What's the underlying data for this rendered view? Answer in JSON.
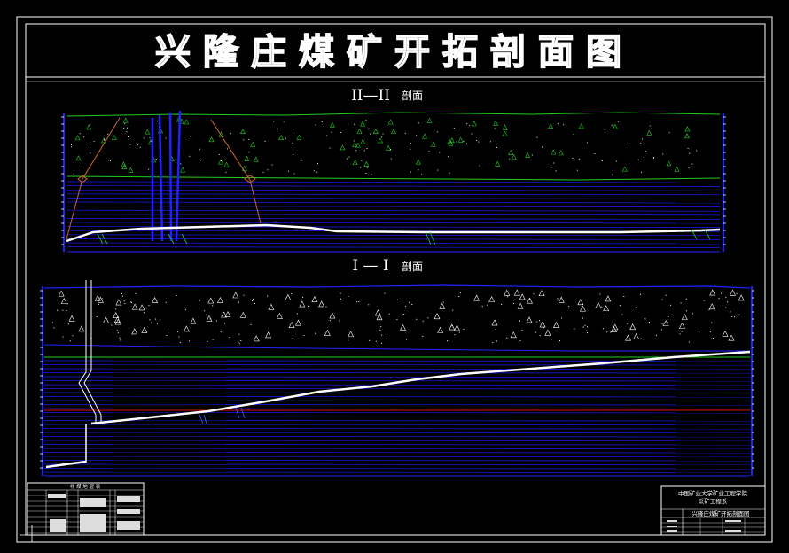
{
  "drawing": {
    "title": "兴隆庄煤矿开拓剖面图",
    "section_top": {
      "label": "II—II",
      "suffix": "剖面"
    },
    "section_bottom": {
      "label": "I — I",
      "suffix": "剖面"
    }
  },
  "legend_table": {
    "header": "非 煤 地 层 表"
  },
  "title_block": {
    "org_line1": "中国矿业大学矿业工程学院",
    "org_line2": "采矿工程系",
    "drawing_name": "兴隆庄煤矿开拓剖面图"
  },
  "colors": {
    "frame": "#ffffff",
    "strata": "#1a1aff",
    "seam": "#ffffff",
    "surface": "#22cc22",
    "level_line": "#dd1111",
    "fault": "#cc6633",
    "shaft": "#2222ff"
  }
}
